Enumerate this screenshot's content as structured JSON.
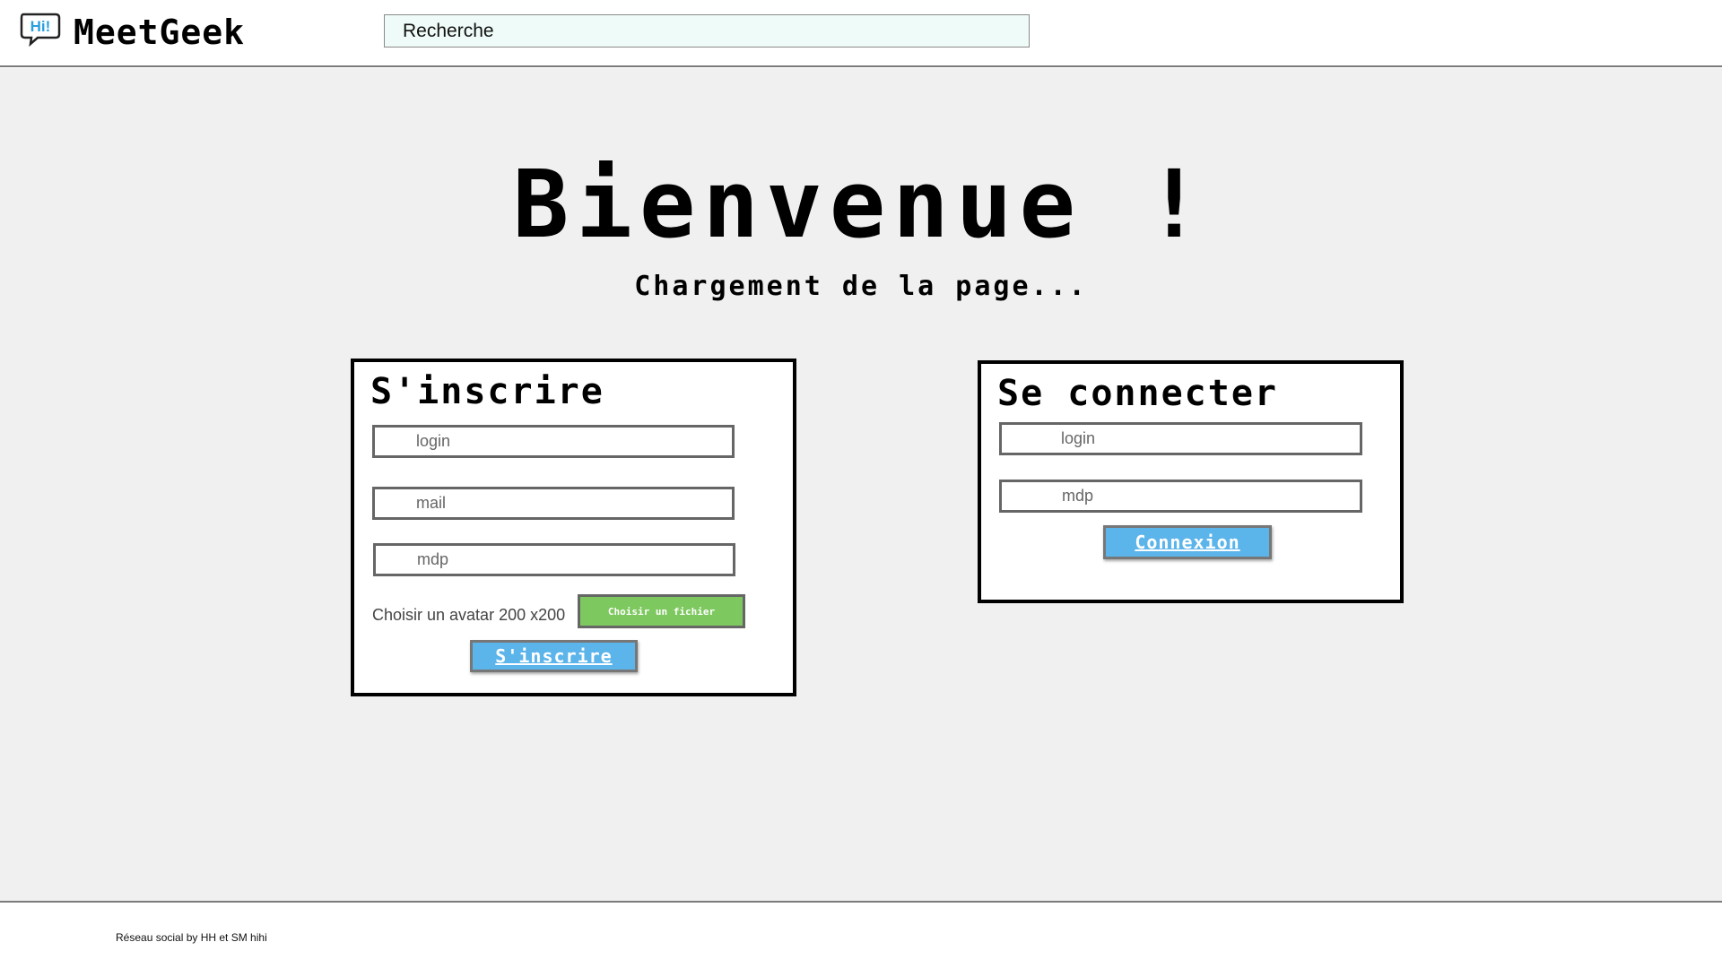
{
  "header": {
    "logo_badge": "Hi!",
    "app_name": "MeetGeek",
    "search_placeholder": "Recherche"
  },
  "main": {
    "title": "Bienvenue !",
    "subtitle": "Chargement de la page..."
  },
  "signup": {
    "title": "S'inscrire",
    "login_placeholder": "login",
    "mail_placeholder": "mail",
    "password_placeholder": "mdp",
    "avatar_label": "Choisir un avatar 200 x200",
    "file_button": "Choisir un fichier",
    "submit": "S'inscrire"
  },
  "signin": {
    "title": "Se connecter",
    "login_placeholder": "login",
    "password_placeholder": "mdp",
    "submit": "Connexion"
  },
  "footer": {
    "text": "Réseau social by HH et SM hihi"
  },
  "colors": {
    "button_blue": "#5bb4ea",
    "file_green": "#7ec860",
    "search_bg": "#effbf8",
    "page_bg": "#f0f0f0"
  }
}
